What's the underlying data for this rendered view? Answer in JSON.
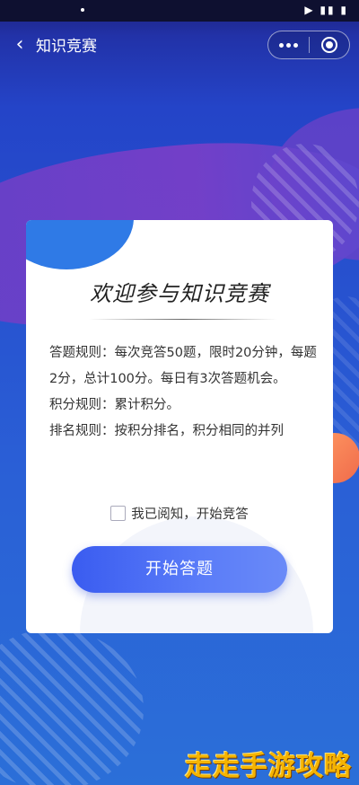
{
  "status_bar": {
    "icons": "▶ ▮▮ ▮"
  },
  "nav": {
    "back_icon": "‹",
    "title": "知识竞赛",
    "more_icon": "more-icon",
    "close_icon": "target-icon"
  },
  "card": {
    "title": "欢迎参与知识竞赛",
    "rules": [
      "答题规则：每次竞答50题，限时20分钟，每题2分，总计100分。每日有3次答题机会。",
      "积分规则：累计积分。",
      "排名规则：按积分排名，积分相同的并列"
    ],
    "agree_label": "我已阅知，开始竞答",
    "agree_checked": false,
    "start_button": "开始答题"
  },
  "watermark": "走走手游攻略",
  "colors": {
    "button": "#4a6cf4",
    "accent_orange": "#f47a54",
    "watermark": "#f5b400"
  }
}
